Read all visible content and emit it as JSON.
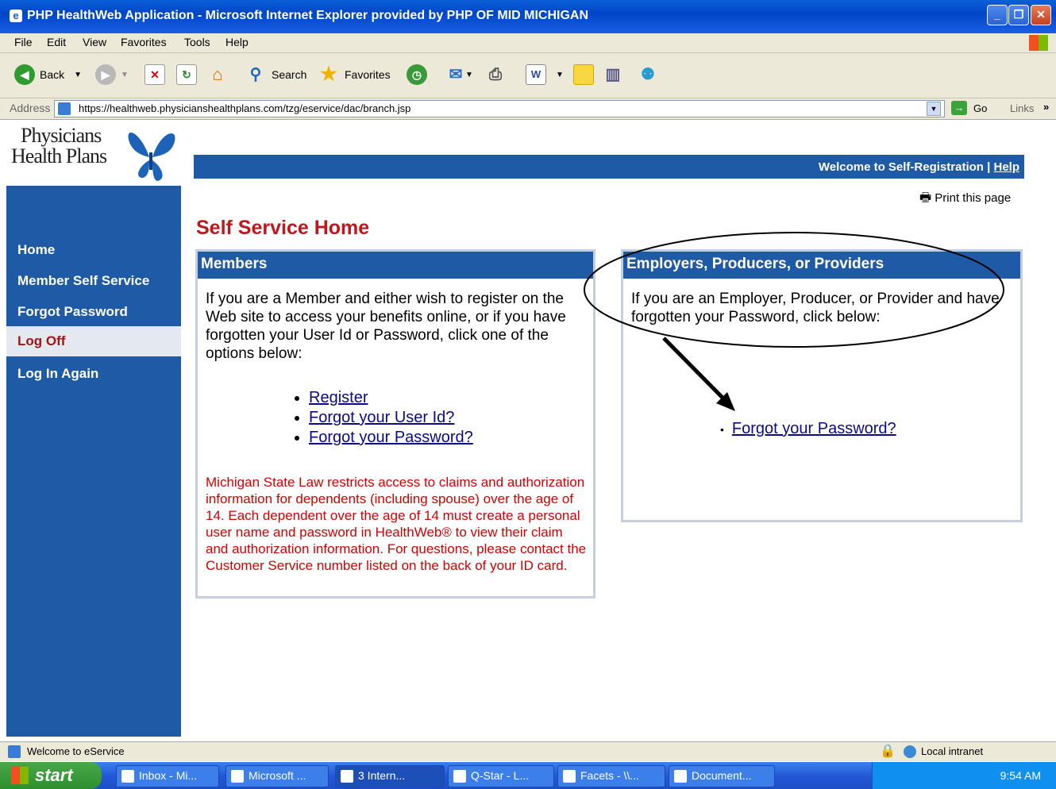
{
  "window": {
    "title": "PHP HealthWeb Application - Microsoft Internet Explorer provided by PHP OF MID MICHIGAN"
  },
  "menu": [
    "File",
    "Edit",
    "View",
    "Favorites",
    "Tools",
    "Help"
  ],
  "toolbar": {
    "back": "Back",
    "search": "Search",
    "favorites": "Favorites"
  },
  "address": {
    "label": "Address",
    "url": "https://healthweb.physicianshealthplans.com/tzg/eservice/dac/branch.jsp",
    "go": "Go",
    "links": "Links"
  },
  "logo": {
    "line1": "Physicians",
    "line2": "Health Plans"
  },
  "nav": [
    {
      "label": "Home"
    },
    {
      "label": "Member Self Service"
    },
    {
      "label": "Forgot Password"
    },
    {
      "label": "Log Off"
    },
    {
      "label": "Log In Again"
    }
  ],
  "header": {
    "welcome": "Welcome to Self-Registration",
    "separator": "|",
    "help": "Help",
    "print": "Print this page"
  },
  "page_title": "Self Service Home",
  "members": {
    "heading": "Members",
    "intro": "If you are a Member and either wish to register on the Web site to access your benefits online, or if you have forgotten your User Id or Password, click one of the options below:",
    "links": [
      "Register",
      "Forgot your User Id?",
      "Forgot your Password?"
    ],
    "notice": "Michigan State Law restricts access to claims and authorization information for dependents (including spouse) over the age of 14. Each dependent over the age of 14 must create a personal user name and password in HealthWeb® to view their claim and authorization information. For questions, please contact the Customer Service number listed on the back of your ID card."
  },
  "employers": {
    "heading": "Employers, Producers, or Providers",
    "intro": "If you are an Employer, Producer, or Provider and have forgotten your Password, click below:",
    "link": "Forgot your Password?"
  },
  "status": {
    "text": "Welcome to eService",
    "zone": "Local intranet"
  },
  "taskbar": {
    "start": "start",
    "tasks": [
      "Inbox - Mi...",
      "Microsoft ...",
      "3 Intern...",
      "Q-Star - L...",
      "Facets - \\\\...",
      "Document..."
    ],
    "clock": "9:54 AM"
  }
}
